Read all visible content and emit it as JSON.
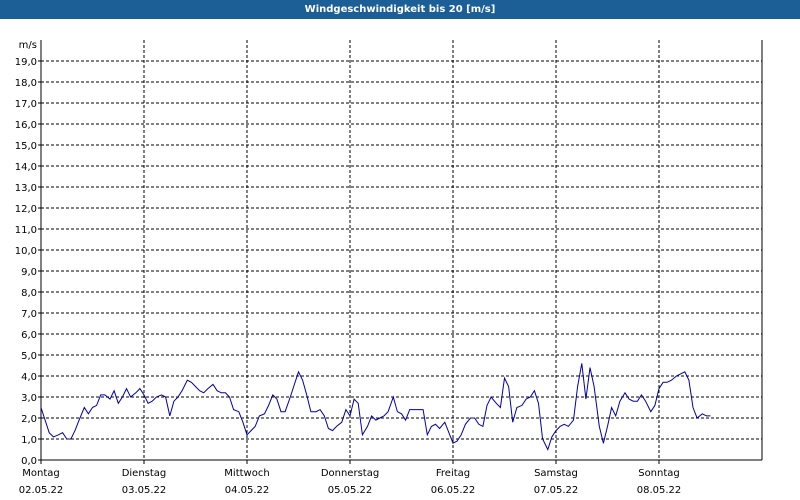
{
  "window": {
    "title": "Windgeschwindigkeit bis 20 [m/s]"
  },
  "chart_data": {
    "type": "line",
    "title": "Windgeschwindigkeit bis 20 [m/s]",
    "ylabel": "m/s",
    "xlabel": "",
    "ylim": [
      0,
      20
    ],
    "y_ticks": [
      "0,0",
      "1,0",
      "2,0",
      "3,0",
      "4,0",
      "5,0",
      "6,0",
      "7,0",
      "8,0",
      "9,0",
      "10,0",
      "11,0",
      "12,0",
      "13,0",
      "14,0",
      "15,0",
      "16,0",
      "17,0",
      "18,0",
      "19,0"
    ],
    "x_days": [
      {
        "weekday": "Montag",
        "date": "02.05.22"
      },
      {
        "weekday": "Dienstag",
        "date": "03.05.22"
      },
      {
        "weekday": "Mittwoch",
        "date": "04.05.22"
      },
      {
        "weekday": "Donnerstag",
        "date": "05.05.22"
      },
      {
        "weekday": "Freitag",
        "date": "06.05.22"
      },
      {
        "weekday": "Samstag",
        "date": "07.05.22"
      },
      {
        "weekday": "Sonntag",
        "date": "08.05.22"
      }
    ],
    "xlim_days": [
      0,
      7.0
    ],
    "grid": true,
    "line_color": "#0000aa",
    "series": [
      {
        "values": [
          [
            0.0,
            2.5
          ],
          [
            0.04,
            1.9
          ],
          [
            0.08,
            1.3
          ],
          [
            0.12,
            1.1
          ],
          [
            0.17,
            1.2
          ],
          [
            0.21,
            1.3
          ],
          [
            0.25,
            1.0
          ],
          [
            0.29,
            1.0
          ],
          [
            0.33,
            1.4
          ],
          [
            0.37,
            1.9
          ],
          [
            0.42,
            2.5
          ],
          [
            0.46,
            2.2
          ],
          [
            0.5,
            2.5
          ],
          [
            0.54,
            2.6
          ],
          [
            0.58,
            3.1
          ],
          [
            0.62,
            3.1
          ],
          [
            0.67,
            2.9
          ],
          [
            0.71,
            3.3
          ],
          [
            0.75,
            2.7
          ],
          [
            0.79,
            3.0
          ],
          [
            0.83,
            3.4
          ],
          [
            0.87,
            3.0
          ],
          [
            0.92,
            3.2
          ],
          [
            0.96,
            3.4
          ],
          [
            1.0,
            3.1
          ],
          [
            1.04,
            2.7
          ],
          [
            1.08,
            2.8
          ],
          [
            1.12,
            3.0
          ],
          [
            1.17,
            3.1
          ],
          [
            1.21,
            3.0
          ],
          [
            1.25,
            2.1
          ],
          [
            1.29,
            2.8
          ],
          [
            1.33,
            3.0
          ],
          [
            1.37,
            3.3
          ],
          [
            1.42,
            3.8
          ],
          [
            1.46,
            3.7
          ],
          [
            1.5,
            3.5
          ],
          [
            1.54,
            3.3
          ],
          [
            1.58,
            3.2
          ],
          [
            1.62,
            3.4
          ],
          [
            1.67,
            3.6
          ],
          [
            1.71,
            3.3
          ],
          [
            1.75,
            3.2
          ],
          [
            1.79,
            3.2
          ],
          [
            1.83,
            3.0
          ],
          [
            1.87,
            2.4
          ],
          [
            1.92,
            2.3
          ],
          [
            1.96,
            1.8
          ],
          [
            2.0,
            1.2
          ],
          [
            2.04,
            1.4
          ],
          [
            2.08,
            1.6
          ],
          [
            2.12,
            2.1
          ],
          [
            2.17,
            2.2
          ],
          [
            2.21,
            2.6
          ],
          [
            2.25,
            3.1
          ],
          [
            2.29,
            2.9
          ],
          [
            2.33,
            2.3
          ],
          [
            2.37,
            2.3
          ],
          [
            2.42,
            3.0
          ],
          [
            2.46,
            3.6
          ],
          [
            2.5,
            4.2
          ],
          [
            2.54,
            3.8
          ],
          [
            2.58,
            3.1
          ],
          [
            2.62,
            2.3
          ],
          [
            2.67,
            2.3
          ],
          [
            2.71,
            2.4
          ],
          [
            2.75,
            2.1
          ],
          [
            2.79,
            1.5
          ],
          [
            2.83,
            1.4
          ],
          [
            2.87,
            1.6
          ],
          [
            2.92,
            1.8
          ],
          [
            2.96,
            2.4
          ],
          [
            3.0,
            2.1
          ],
          [
            3.04,
            2.9
          ],
          [
            3.08,
            2.7
          ],
          [
            3.12,
            1.2
          ],
          [
            3.17,
            1.6
          ],
          [
            3.21,
            2.1
          ],
          [
            3.25,
            1.9
          ],
          [
            3.29,
            2.0
          ],
          [
            3.33,
            2.1
          ],
          [
            3.37,
            2.3
          ],
          [
            3.42,
            3.0
          ],
          [
            3.46,
            2.3
          ],
          [
            3.5,
            2.2
          ],
          [
            3.54,
            1.9
          ],
          [
            3.58,
            2.4
          ],
          [
            3.62,
            2.4
          ],
          [
            3.67,
            2.4
          ],
          [
            3.71,
            2.4
          ],
          [
            3.75,
            1.2
          ],
          [
            3.79,
            1.6
          ],
          [
            3.83,
            1.7
          ],
          [
            3.87,
            1.5
          ],
          [
            3.92,
            1.8
          ],
          [
            3.96,
            1.3
          ],
          [
            4.0,
            0.8
          ],
          [
            4.04,
            0.9
          ],
          [
            4.08,
            1.2
          ],
          [
            4.12,
            1.7
          ],
          [
            4.17,
            2.0
          ],
          [
            4.21,
            2.0
          ],
          [
            4.25,
            1.7
          ],
          [
            4.29,
            1.6
          ],
          [
            4.33,
            2.6
          ],
          [
            4.37,
            3.0
          ],
          [
            4.42,
            2.7
          ],
          [
            4.46,
            2.5
          ],
          [
            4.5,
            3.9
          ],
          [
            4.54,
            3.5
          ],
          [
            4.58,
            1.8
          ],
          [
            4.62,
            2.5
          ],
          [
            4.67,
            2.6
          ],
          [
            4.71,
            2.9
          ],
          [
            4.75,
            3.0
          ],
          [
            4.79,
            3.3
          ],
          [
            4.83,
            2.7
          ],
          [
            4.87,
            1.0
          ],
          [
            4.92,
            0.5
          ],
          [
            4.96,
            1.1
          ],
          [
            5.0,
            1.4
          ],
          [
            5.04,
            1.6
          ],
          [
            5.08,
            1.7
          ],
          [
            5.12,
            1.6
          ],
          [
            5.17,
            1.9
          ],
          [
            5.21,
            3.5
          ],
          [
            5.25,
            4.6
          ],
          [
            5.29,
            2.9
          ],
          [
            5.33,
            4.4
          ],
          [
            5.37,
            3.5
          ],
          [
            5.42,
            1.6
          ],
          [
            5.46,
            0.8
          ],
          [
            5.5,
            1.6
          ],
          [
            5.54,
            2.5
          ],
          [
            5.58,
            2.1
          ],
          [
            5.62,
            2.8
          ],
          [
            5.67,
            3.2
          ],
          [
            5.71,
            2.9
          ],
          [
            5.75,
            2.8
          ],
          [
            5.79,
            2.8
          ],
          [
            5.83,
            3.1
          ],
          [
            5.87,
            2.8
          ],
          [
            5.92,
            2.3
          ],
          [
            5.96,
            2.6
          ],
          [
            6.0,
            3.4
          ],
          [
            6.04,
            3.7
          ],
          [
            6.08,
            3.7
          ],
          [
            6.12,
            3.8
          ],
          [
            6.17,
            4.0
          ],
          [
            6.21,
            4.1
          ],
          [
            6.25,
            4.2
          ],
          [
            6.29,
            3.8
          ],
          [
            6.33,
            2.5
          ],
          [
            6.37,
            2.0
          ],
          [
            6.42,
            2.2
          ],
          [
            6.46,
            2.1
          ],
          [
            6.5,
            2.1
          ]
        ]
      }
    ]
  }
}
